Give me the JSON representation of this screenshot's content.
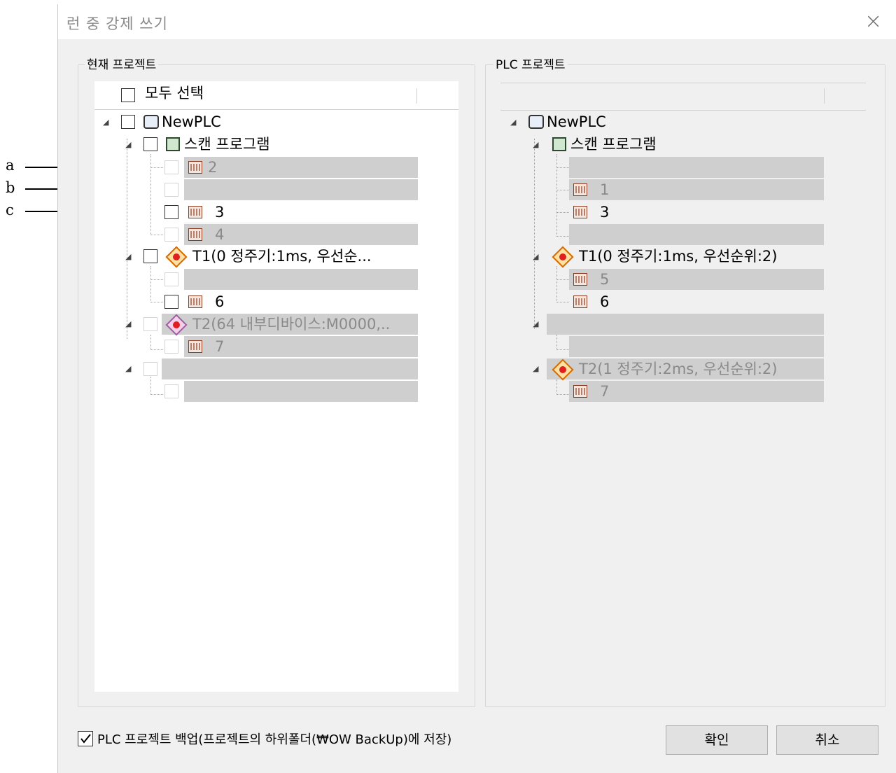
{
  "dialog": {
    "title": "런 중 강제 쓰기",
    "close_icon": "×"
  },
  "left_panel": {
    "legend": "현재 프로젝트",
    "select_all": "모두 선택",
    "plc_name": "NewPLC",
    "scan_program": "스캔 프로그램",
    "items": [
      "2",
      "",
      "3",
      "4"
    ],
    "task1": "T1(0 정주기:1ms, 우선순...",
    "task1_items": [
      "",
      "6"
    ],
    "task2": "T2(64 내부디바이스:M0000,..",
    "task2_items": [
      "7"
    ]
  },
  "right_panel": {
    "legend": "PLC 프로젝트",
    "plc_name": "NewPLC",
    "scan_program": "스캔 프로그램",
    "items": [
      "",
      "1",
      "3",
      ""
    ],
    "task1": "T1(0 정주기:1ms, 우선순위:2)",
    "task1_items": [
      "5",
      "6"
    ],
    "task2": "T2(1 정주기:2ms, 우선순위:2)",
    "task2_items": [
      "7"
    ]
  },
  "annotations": [
    "a",
    "b",
    "c"
  ],
  "footer": {
    "backup_label": "PLC 프로젝트 백업(프로젝트의 하위폴더(₩OW BackUp)에 저장)",
    "ok": "확인",
    "cancel": "취소"
  }
}
